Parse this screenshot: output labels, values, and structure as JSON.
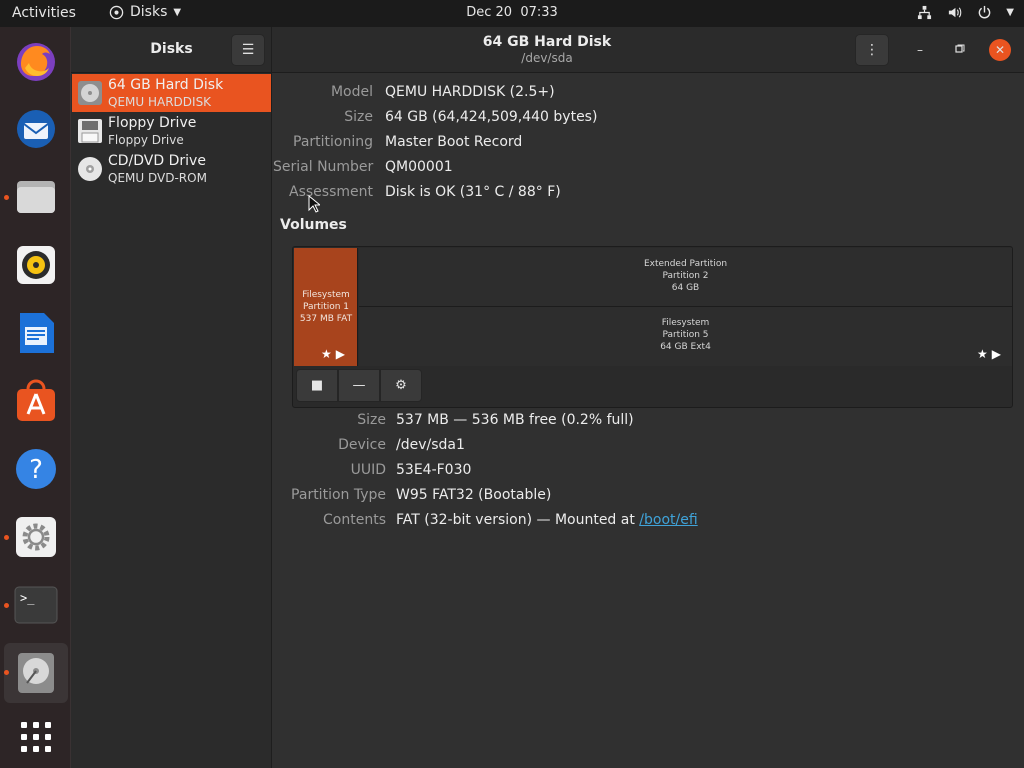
{
  "topbar": {
    "activities": "Activities",
    "app_name": "Disks",
    "clock_date": "Dec 20",
    "clock_time": "07:33"
  },
  "dock": {
    "items": [
      "firefox-icon",
      "thunderbird-icon",
      "files-icon",
      "rhythmbox-icon",
      "writer-icon",
      "software-icon",
      "help-icon",
      "settings-icon",
      "terminal-icon",
      "disks-icon",
      "app-grid-icon"
    ]
  },
  "header": {
    "sidebar_title": "Disks",
    "title": "64 GB Hard Disk",
    "subtitle": "/dev/sda"
  },
  "devices": [
    {
      "name": "64 GB Hard Disk",
      "sub": "QEMU HARDDISK",
      "icon": "hard-disk-icon",
      "selected": true
    },
    {
      "name": "Floppy Drive",
      "sub": "Floppy Drive",
      "icon": "floppy-icon",
      "selected": false
    },
    {
      "name": "CD/DVD Drive",
      "sub": "QEMU DVD-ROM",
      "icon": "optical-disc-icon",
      "selected": false
    }
  ],
  "disk_info": {
    "model_label": "Model",
    "model": "QEMU HARDDISK (2.5+)",
    "size_label": "Size",
    "size": "64 GB (64,424,509,440 bytes)",
    "partitioning_label": "Partitioning",
    "partitioning": "Master Boot Record",
    "serial_label": "Serial Number",
    "serial": "QM00001",
    "assessment_label": "Assessment",
    "assessment": "Disk is OK (31° C / 88° F)"
  },
  "volumes": {
    "title": "Volumes",
    "p1": {
      "line1": "Filesystem",
      "line2": "Partition 1",
      "line3": "537 MB FAT"
    },
    "ext": {
      "line1": "Extended Partition",
      "line2": "Partition 2",
      "line3": "64 GB"
    },
    "p5": {
      "line1": "Filesystem",
      "line2": "Partition 5",
      "line3": "64 GB Ext4"
    }
  },
  "partition_info": {
    "size_label": "Size",
    "size": "537 MB — 536 MB free (0.2% full)",
    "device_label": "Device",
    "device": "/dev/sda1",
    "uuid_label": "UUID",
    "uuid": "53E4-F030",
    "type_label": "Partition Type",
    "type": "W95 FAT32 (Bootable)",
    "contents_label": "Contents",
    "contents_prefix": "FAT (32-bit version) — Mounted at ",
    "contents_link": "/boot/efi"
  },
  "colors": {
    "accent": "#e95420",
    "partition_selected": "#a8441d",
    "link": "#3fa3d9"
  }
}
